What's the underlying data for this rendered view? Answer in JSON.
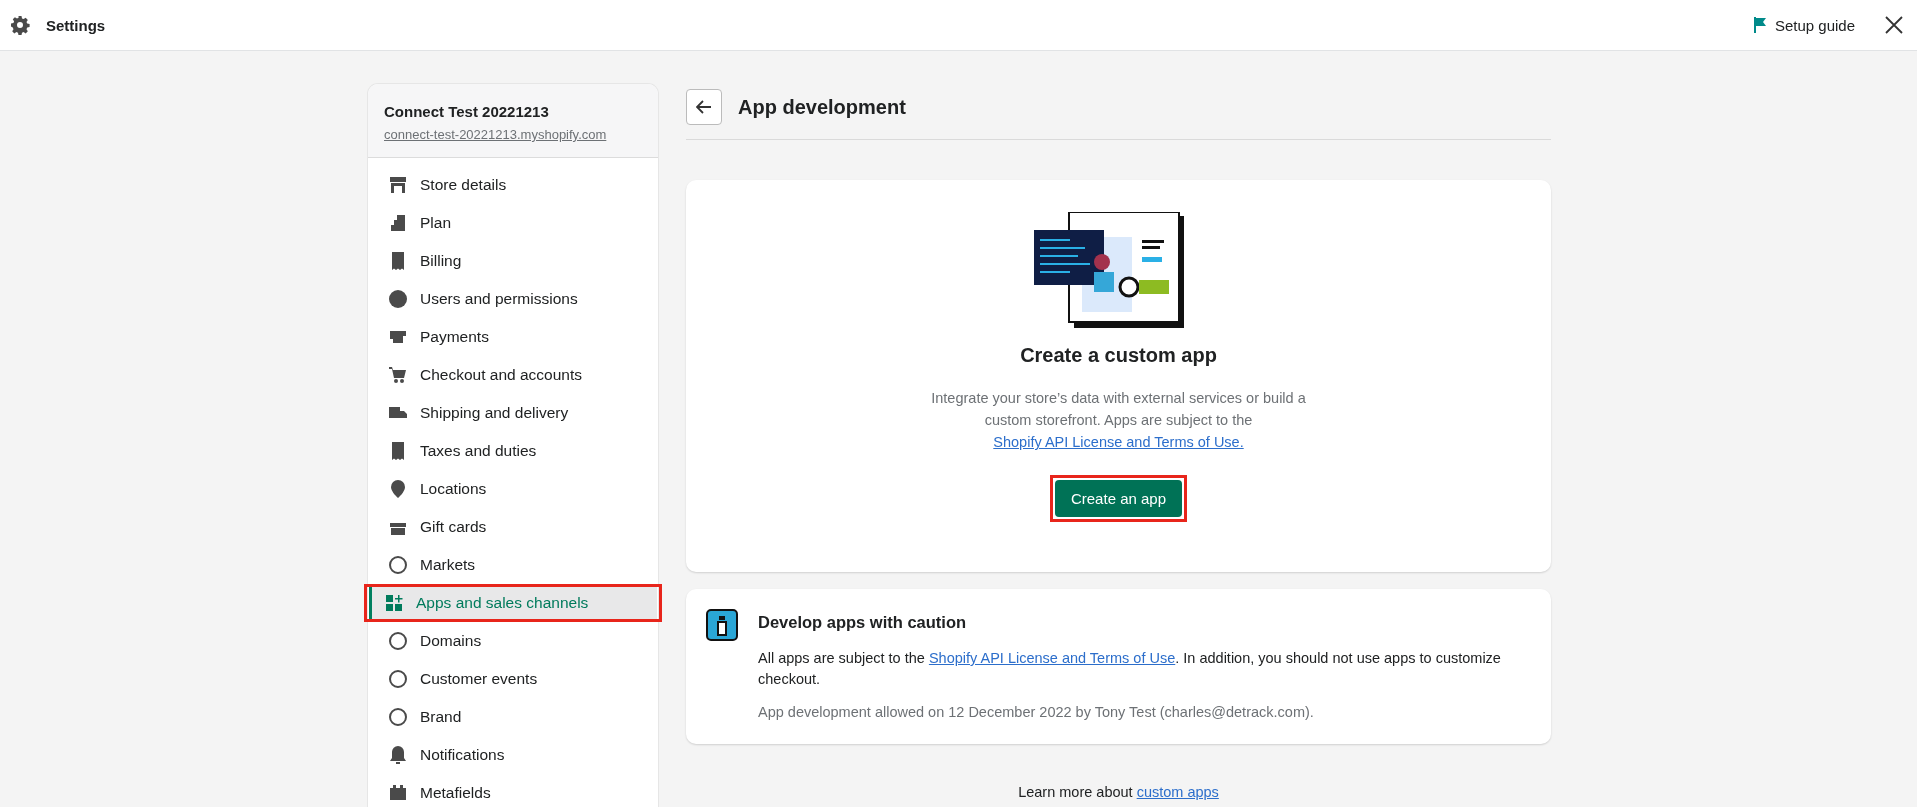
{
  "top_bar": {
    "title": "Settings",
    "setup_guide": "Setup guide"
  },
  "sidebar": {
    "store_name": "Connect Test 20221213",
    "store_url": "connect-test-20221213.myshopify.com",
    "items": [
      {
        "label": "Store details",
        "selected": false,
        "annotated": false
      },
      {
        "label": "Plan",
        "selected": false,
        "annotated": false
      },
      {
        "label": "Billing",
        "selected": false,
        "annotated": false
      },
      {
        "label": "Users and permissions",
        "selected": false,
        "annotated": false
      },
      {
        "label": "Payments",
        "selected": false,
        "annotated": false
      },
      {
        "label": "Checkout and accounts",
        "selected": false,
        "annotated": false
      },
      {
        "label": "Shipping and delivery",
        "selected": false,
        "annotated": false
      },
      {
        "label": "Taxes and duties",
        "selected": false,
        "annotated": false
      },
      {
        "label": "Locations",
        "selected": false,
        "annotated": false
      },
      {
        "label": "Gift cards",
        "selected": false,
        "annotated": false
      },
      {
        "label": "Markets",
        "selected": false,
        "annotated": false
      },
      {
        "label": "Apps and sales channels",
        "selected": true,
        "annotated": true
      },
      {
        "label": "Domains",
        "selected": false,
        "annotated": false
      },
      {
        "label": "Customer events",
        "selected": false,
        "annotated": false
      },
      {
        "label": "Brand",
        "selected": false,
        "annotated": false
      },
      {
        "label": "Notifications",
        "selected": false,
        "annotated": false
      },
      {
        "label": "Metafields",
        "selected": false,
        "annotated": false
      }
    ]
  },
  "page": {
    "title": "App development",
    "custom_app_card": {
      "heading": "Create a custom app",
      "text": "Integrate your store’s data with external services or build a custom storefront. Apps are subject to the",
      "link": "Shopify API License and Terms of Use.",
      "button": "Create an app",
      "button_annotated": true
    },
    "caution_card": {
      "heading": "Develop apps with caution",
      "text_before": "All apps are subject to the",
      "link": "Shopify API License and Terms of Use",
      "text_after": ". In addition, you should not use apps to customize checkout.",
      "note": "App development allowed on 12 December 2022 by Tony Test (charles@detrack.com)."
    },
    "footer": {
      "text": "Learn more about",
      "link": "custom apps"
    }
  }
}
